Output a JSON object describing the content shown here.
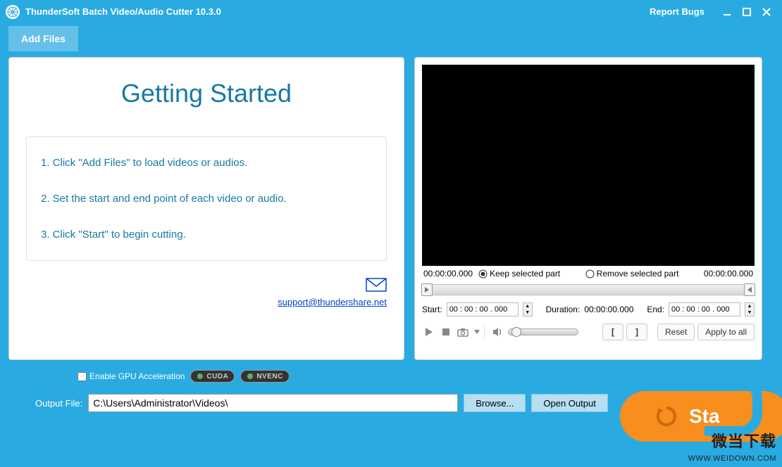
{
  "titlebar": {
    "title": "ThunderSoft Batch Video/Audio Cutter 10.3.0",
    "report": "Report Bugs"
  },
  "toolbar": {
    "add_files": "Add Files"
  },
  "getting_started": {
    "title": "Getting Started",
    "step1": "1. Click \"Add Files\" to load videos or audios.",
    "step2": "2. Set the start and end point of each video or audio.",
    "step3": "3. Click \"Start\" to begin cutting.",
    "support_email": "support@thundershare.net"
  },
  "preview": {
    "time_left": "00:00:00.000",
    "keep_label": "Keep selected part",
    "remove_label": "Remove selected part",
    "time_right": "00:00:00.000",
    "start_label": "Start:",
    "start_value": "00 : 00 : 00 . 000",
    "duration_label": "Duration:",
    "duration_value": "00:00:00.000",
    "end_label": "End:",
    "end_value": "00 : 00 : 00 . 000",
    "reset": "Reset",
    "apply_all": "Apply to all"
  },
  "bottom": {
    "gpu_label": "Enable GPU Acceleration",
    "cuda": "CUDA",
    "nvenc": "NVENC",
    "output_label": "Output File:",
    "output_path": "C:\\Users\\Administrator\\Videos\\",
    "browse": "Browse...",
    "open_output": "Open Output"
  },
  "start_btn": "Sta",
  "watermark": {
    "cn": "微当下载",
    "url": "WWW.WEIDOWN.COM"
  }
}
